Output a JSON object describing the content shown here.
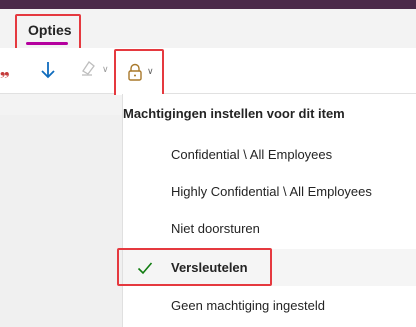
{
  "tabs": {
    "active_label": "Opties"
  },
  "ribbon": {
    "icons": [
      "down-arrow-icon",
      "clear-format-icon",
      "lock-icon",
      "chevron-down-icon"
    ]
  },
  "menu": {
    "header": "Machtigingen instellen voor dit item",
    "items": [
      {
        "label": "Confidential \\ All Employees",
        "checked": false
      },
      {
        "label": "Highly Confidential \\ All Employees",
        "checked": false
      },
      {
        "label": "Niet doorsturen",
        "checked": false
      },
      {
        "label": "Versleutelen",
        "checked": true
      },
      {
        "label": "Geen machtiging ingesteld",
        "checked": false
      }
    ]
  },
  "colors": {
    "accent": "#b4009e",
    "highlight": "#e5393f",
    "top_bar": "#4b2a4a",
    "check": "#107c10",
    "arrow": "#0f6cbd"
  }
}
